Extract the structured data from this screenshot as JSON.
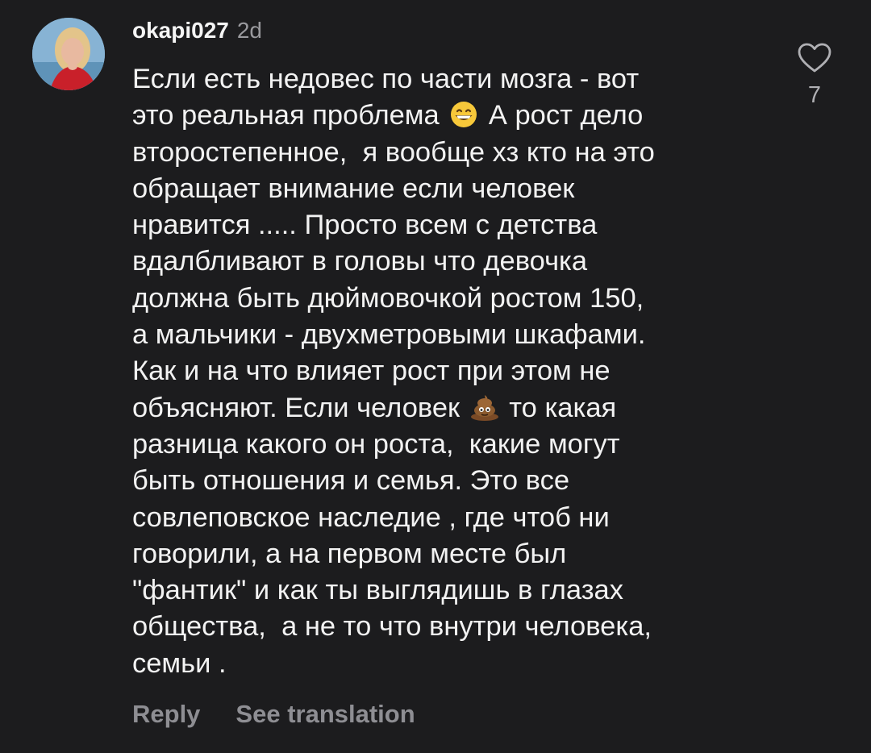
{
  "comment": {
    "username": "okapi027",
    "timestamp": "2d",
    "text_parts": [
      "Если есть недовес по части мозга - вот\nэто реальная проблема ",
      " А рост дело\nвторостепенное,  я вообще хз кто на это\nобращает внимание если человек\nнравится ..... Просто всем с детства\nвдалбливают в головы что девочка\nдолжна быть дюймовочкой ростом 150,\nа мальчики - двухметровыми шкафами.\nКак и на что влияет рост при этом не\nобъясняют. Если человек ",
      " то какая\nразница какого он роста,  какие могут\nбыть отношения и семья. Это все\nсовлеповское наследие , где чтоб ни\nговорили, а на первом месте был\n\"фантик\" и как ты выглядишь в глазах\nобщества,  а не то что внутри человека,\nсемьи ."
    ],
    "emojis": [
      "grinning-face-emoji",
      "pile-of-poo-emoji"
    ],
    "like_count": "7",
    "like_icon": "heart-outline-icon",
    "actions": {
      "reply": "Reply",
      "translate": "See translation"
    }
  }
}
